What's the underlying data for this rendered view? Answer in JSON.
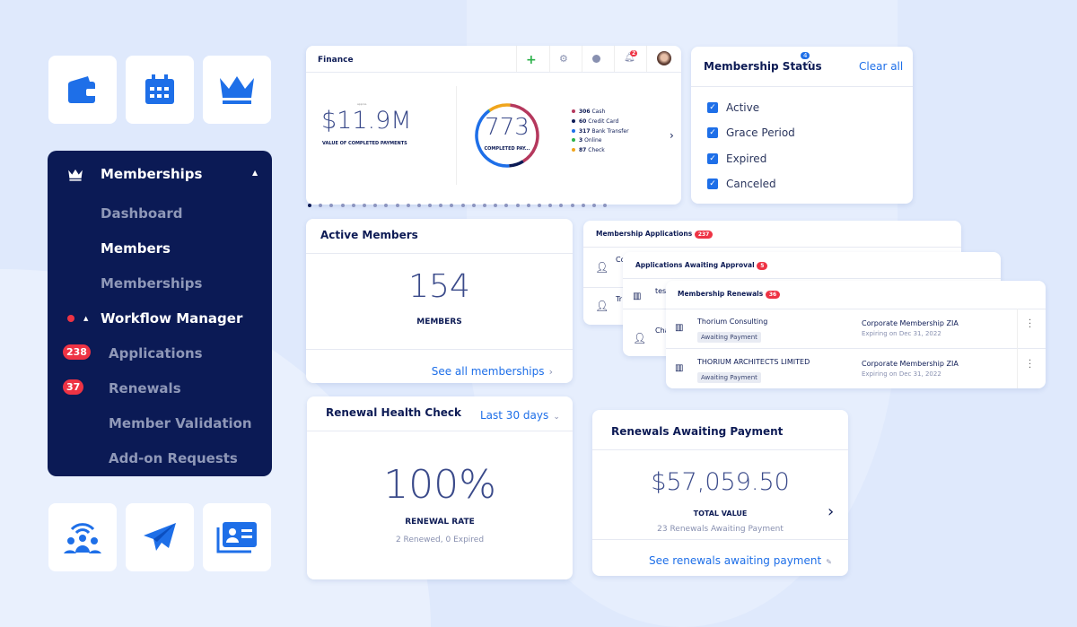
{
  "colors": {
    "accent": "#1e6fe8",
    "navy": "#0b1a55",
    "badge": "#ee3344",
    "cash": "#b5385d",
    "credit": "#0b1a55",
    "bank": "#1e6fe8",
    "online": "#2bb14a",
    "check": "#f0a51c"
  },
  "tiles_top": [
    "wallet-icon",
    "calendar-icon",
    "crown-icon"
  ],
  "tiles_bottom": [
    "community-icon",
    "send-icon",
    "contact-card-icon"
  ],
  "sidebar": {
    "title": "Memberships",
    "items": [
      "Dashboard",
      "Members",
      "Memberships"
    ],
    "workflow": "Workflow Manager",
    "sub": [
      {
        "label": "Applications",
        "badge": "238"
      },
      {
        "label": "Renewals",
        "badge": "37"
      },
      {
        "label": "Member Validation"
      },
      {
        "label": "Add-on Requests"
      }
    ]
  },
  "finance": {
    "title": "Finance",
    "notif_count": "2",
    "approx": "approx.",
    "amount": "$11.9M",
    "amount_label": "VALUE OF COMPLETED PAYMENTS",
    "count": "773",
    "count_label": "COMPLETED PAY...",
    "legend": [
      {
        "n": "306",
        "label": "Cash"
      },
      {
        "n": "60",
        "label": "Credit Card"
      },
      {
        "n": "317",
        "label": "Bank Transfer"
      },
      {
        "n": "3",
        "label": "Online"
      },
      {
        "n": "87",
        "label": "Check"
      }
    ]
  },
  "status": {
    "title": "Membership Status",
    "count": "4",
    "clear": "Clear all",
    "options": [
      "Active",
      "Grace Period",
      "Expired",
      "Canceled"
    ]
  },
  "active": {
    "title": "Active Members",
    "value": "154",
    "label": "MEMBERS",
    "link": "See all memberships"
  },
  "applications": {
    "title": "Membership Applications",
    "badge": "237",
    "rows": [
      "Co",
      "Tr"
    ]
  },
  "approval": {
    "title": "Applications Awaiting Approval",
    "badge": "5",
    "rows": [
      "tes",
      "Cha"
    ]
  },
  "renewals": {
    "title": "Membership Renewals",
    "badge": "36",
    "rows": [
      {
        "name": "Thorium Consulting",
        "status": "Awaiting Payment",
        "plan": "Corporate Membership ZIA",
        "exp": "Expiring on Dec 31, 2022"
      },
      {
        "name": "THORIUM ARCHITECTS LIMITED",
        "status": "Awaiting Payment",
        "plan": "Corporate Membership ZIA",
        "exp": "Expiring on Dec 31, 2022"
      }
    ]
  },
  "health": {
    "title": "Renewal Health Check",
    "range": "Last 30 days",
    "value": "100%",
    "label": "RENEWAL RATE",
    "sub": "2 Renewed, 0 Expired"
  },
  "payment": {
    "title": "Renewals Awaiting Payment",
    "value": "$57,059.50",
    "label": "TOTAL VALUE",
    "sub": "23 Renewals Awaiting Payment",
    "link": "See renewals awaiting payment"
  }
}
